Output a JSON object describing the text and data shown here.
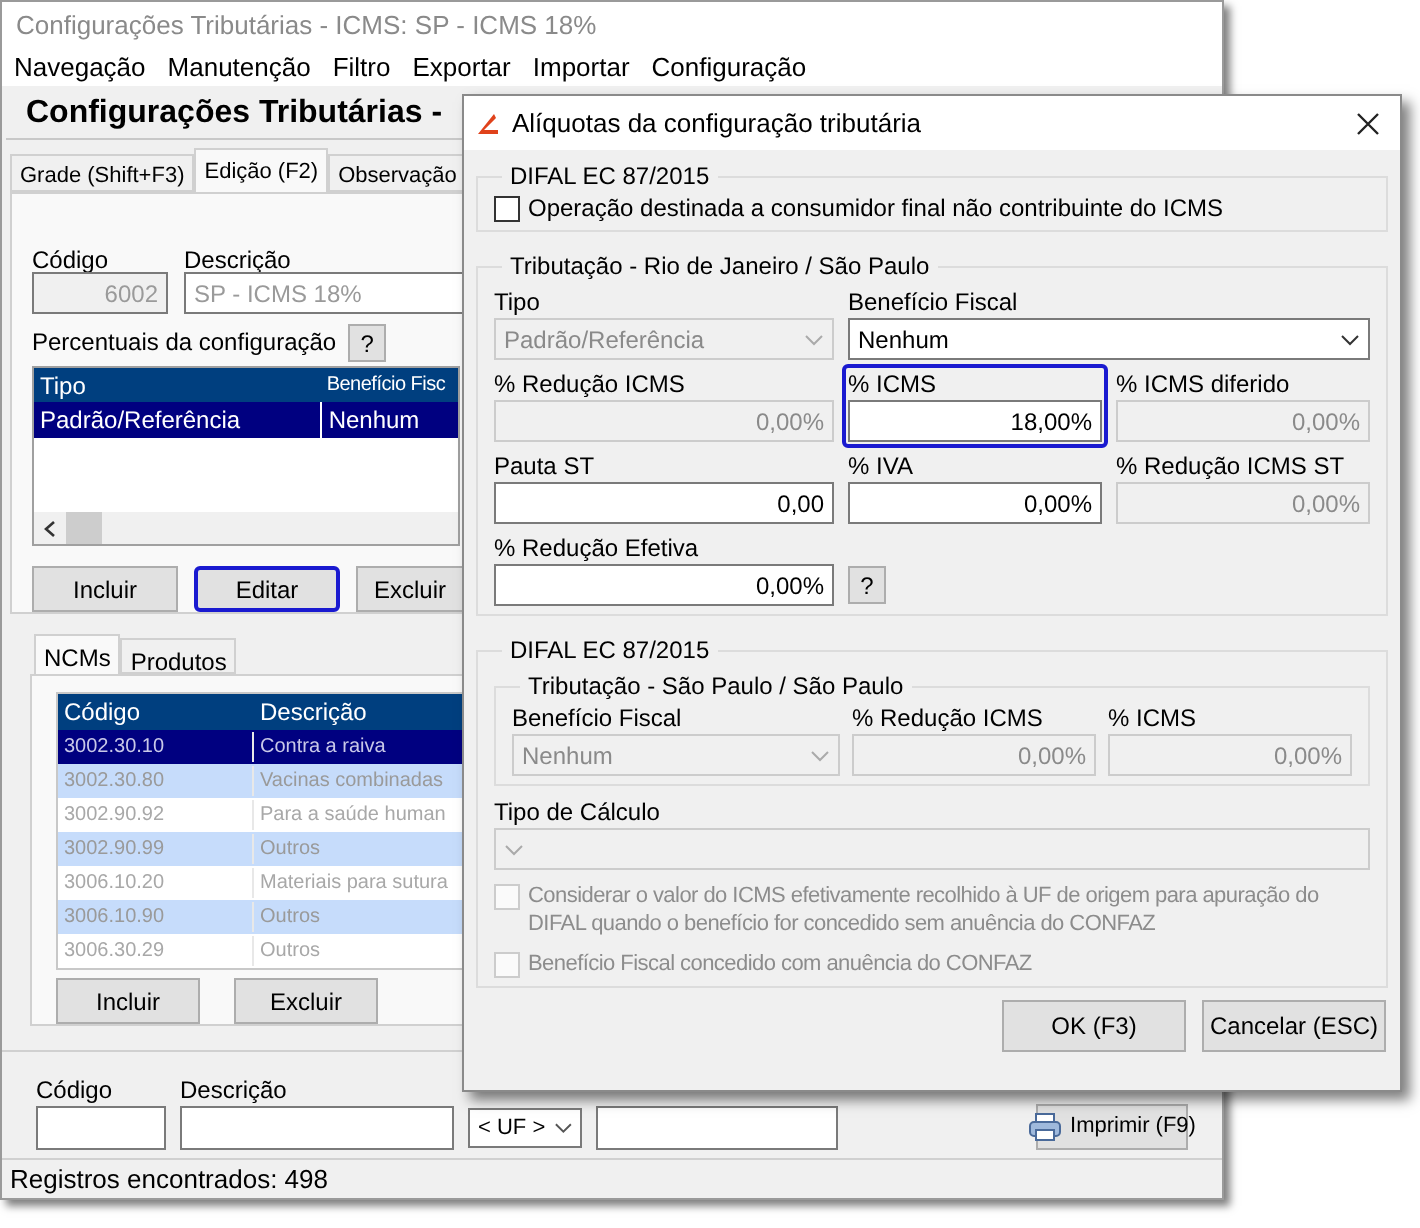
{
  "main_window": {
    "title": "Configurações Tributárias - ICMS: SP - ICMS 18%",
    "menu": [
      "Navegação",
      "Manutenção",
      "Filtro",
      "Exportar",
      "Importar",
      "Configuração"
    ],
    "heading": "Configurações Tributárias -",
    "tabs": [
      {
        "label": "Grade (Shift+F3)",
        "selected": false
      },
      {
        "label": "Edição (F2)",
        "selected": true
      },
      {
        "label": "Observação",
        "selected": false
      }
    ],
    "codigo": {
      "label": "Código",
      "value": "6002"
    },
    "descricao": {
      "label": "Descrição",
      "value": "SP - ICMS 18%"
    },
    "percentuais": {
      "label": "Percentuais da configuração",
      "help": "?",
      "columns": [
        "Tipo",
        "Benefício Fisc"
      ],
      "rows": [
        {
          "cells": [
            "Padrão/Referência",
            "Nenhum"
          ],
          "selected": true
        }
      ]
    },
    "buttons": [
      {
        "label": "Incluir",
        "focused": false
      },
      {
        "label": "Editar",
        "focused": true
      },
      {
        "label": "Excluir",
        "focused": false
      }
    ],
    "subtabs": [
      {
        "label": "NCMs",
        "selected": true
      },
      {
        "label": "Produtos",
        "selected": false
      }
    ],
    "ncm_table": {
      "columns": [
        "Código",
        "Descrição"
      ],
      "rows": [
        {
          "cells": [
            "3002.30.10",
            "Contra a raiva"
          ],
          "selected": true
        },
        {
          "cells": [
            "3002.30.80",
            "Vacinas combinadas"
          ],
          "selected": false
        },
        {
          "cells": [
            "3002.90.92",
            "Para a saúde human"
          ],
          "selected": false
        },
        {
          "cells": [
            "3002.90.99",
            "Outros"
          ],
          "selected": false
        },
        {
          "cells": [
            "3006.10.20",
            "Materiais para sutura"
          ],
          "selected": false
        },
        {
          "cells": [
            "3006.10.90",
            "Outros"
          ],
          "selected": false
        },
        {
          "cells": [
            "3006.30.29",
            "Outros"
          ],
          "selected": false
        }
      ]
    },
    "ncm_buttons": [
      "Incluir",
      "Excluir"
    ],
    "filter": {
      "codigo_label": "Código",
      "descricao_label": "Descrição",
      "uf": "< UF >",
      "print_button": "Imprimir (F9)"
    },
    "status_bar": "Registros encontrados: 498"
  },
  "dialog": {
    "title": "Alíquotas da configuração tributária",
    "group1": {
      "title": "DIFAL EC 87/2015",
      "checkbox": {
        "label": "Operação destinada a consumidor final não contribuinte do ICMS",
        "checked": false,
        "disabled": false
      }
    },
    "group2": {
      "title": "Tributação - Rio de Janeiro / São Paulo",
      "rows": [
        [
          {
            "label": "Tipo",
            "value": "Padrão/Referência",
            "kind": "select",
            "disabled": true,
            "focused": false
          },
          {
            "label": "Benefício Fiscal",
            "value": "Nenhum",
            "kind": "select",
            "disabled": false,
            "focused": false
          }
        ],
        [
          {
            "label": "% Redução ICMS",
            "value": "0,00%",
            "kind": "input",
            "disabled": true,
            "focused": false
          },
          {
            "label": "% ICMS",
            "value": "18,00%",
            "kind": "input",
            "disabled": false,
            "focused": true
          },
          {
            "label": "% ICMS diferido",
            "value": "0,00%",
            "kind": "input",
            "disabled": true,
            "focused": false
          }
        ],
        [
          {
            "label": "Pauta ST",
            "value": "0,00",
            "kind": "input",
            "disabled": false,
            "focused": false
          },
          {
            "label": "% IVA",
            "value": "0,00%",
            "kind": "input",
            "disabled": false,
            "focused": false
          },
          {
            "label": "% Redução ICMS ST",
            "value": "0,00%",
            "kind": "input",
            "disabled": true,
            "focused": false
          }
        ],
        [
          {
            "label": "% Redução Efetiva",
            "value": "0,00%",
            "kind": "input",
            "disabled": false,
            "focused": false
          }
        ]
      ],
      "help": "?"
    },
    "group3": {
      "title": "DIFAL EC 87/2015",
      "subgroup": {
        "title": "Tributação - São Paulo / São Paulo",
        "fields": [
          {
            "label": "Benefício Fiscal",
            "value": "Nenhum",
            "kind": "select",
            "disabled": true,
            "focused": false
          },
          {
            "label": "% Redução ICMS",
            "value": "0,00%",
            "kind": "input",
            "disabled": true,
            "focused": false
          },
          {
            "label": "% ICMS",
            "value": "0,00%",
            "kind": "input",
            "disabled": true,
            "focused": false
          }
        ]
      },
      "tipo_calculo": {
        "label": "Tipo de Cálculo",
        "kind": "select",
        "disabled": true,
        "focused": false
      },
      "checkboxes": [
        {
          "label": "Considerar o valor do ICMS efetivamente recolhido à UF de origem para apuração do DIFAL quando o benefício for concedido sem anuência do CONFAZ",
          "checked": false,
          "disabled": true
        },
        {
          "label": "Benefício Fiscal concedido com anuência do CONFAZ",
          "checked": false,
          "disabled": true
        }
      ]
    },
    "buttons": [
      "OK (F3)",
      "Cancelar (ESC)"
    ]
  }
}
